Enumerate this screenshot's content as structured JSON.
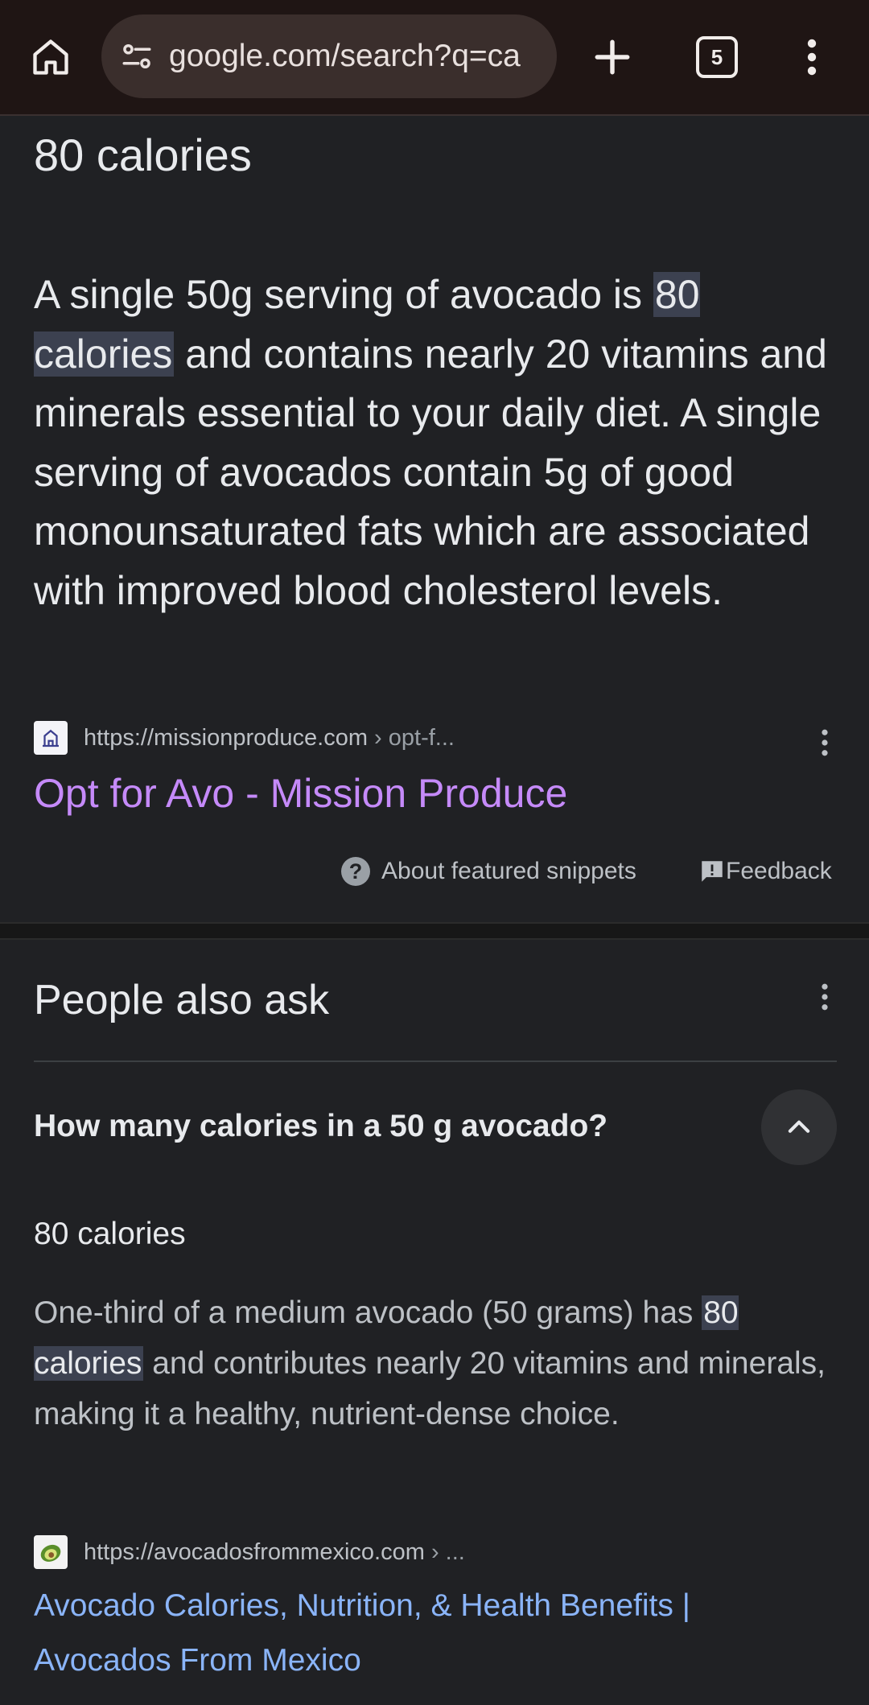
{
  "browser": {
    "url": "google.com/search?q=ca",
    "tab_count": "5",
    "icons": {
      "home": "home-icon",
      "site_info": "tune-icon",
      "new_tab": "plus-icon",
      "tabs": "tabs-icon",
      "menu": "more-vert-icon"
    }
  },
  "featured_snippet": {
    "title": "80 calories",
    "body_before": "A single 50g serving of avocado is ",
    "body_highlight": "80 calories",
    "body_after": " and contains nearly 20 vitamins and minerals essential to your daily diet. A single serving of avocados contain 5g of good monounsaturated fats which are associated with improved blood cholesterol levels.",
    "source_url": "https://missionproduce.com",
    "source_path": " › opt-f...",
    "link_title": "Opt for Avo - Mission Produce",
    "about_label": "About featured snippets",
    "feedback_label": "Feedback"
  },
  "people_also_ask": {
    "title": "People also ask",
    "question": "How many calories in a 50 g avocado?",
    "answer_title": "80 calories",
    "answer_before": "One-third of a medium avocado (50 grams) has ",
    "answer_highlight": "80 calories",
    "answer_after": " and contributes nearly 20 vitamins and minerals, making it a healthy, nutrient-dense choice.",
    "source_url": "https://avocadosfrommexico.com",
    "source_path": " › ...",
    "link_title": "Avocado Calories, Nutrition, & Health Benefits | Avocados From Mexico"
  },
  "colors": {
    "background": "#202124",
    "toolbar": "#1f1514",
    "visited_link": "#c58af9",
    "link": "#8ab4f8",
    "highlight": "#3c4150"
  }
}
